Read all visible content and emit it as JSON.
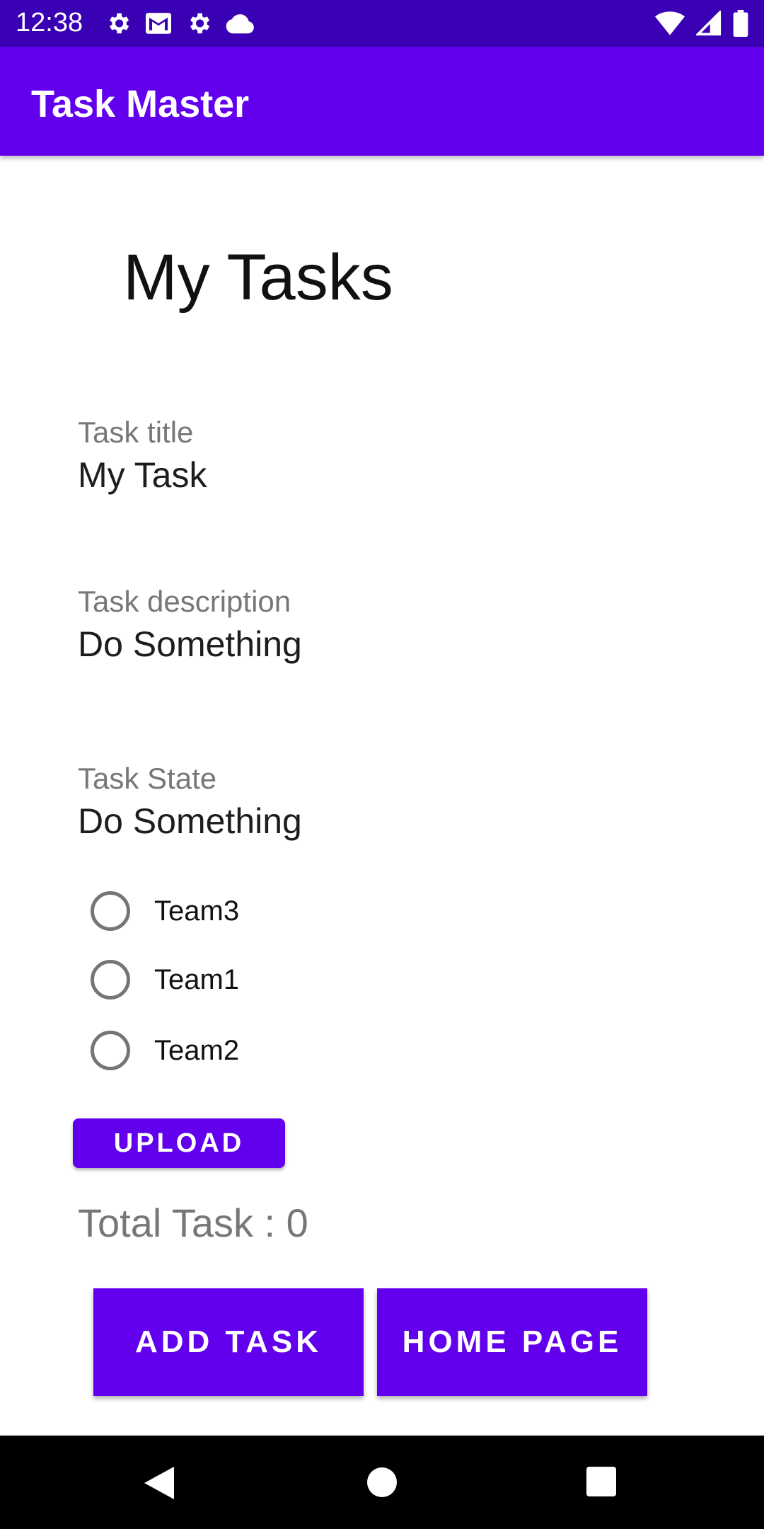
{
  "status_bar": {
    "time": "12:38",
    "left_icons": [
      "gear-icon",
      "gmail-icon",
      "gear-icon",
      "cloud-icon"
    ],
    "right_icons": [
      "wifi-icon",
      "signal-icon",
      "battery-icon"
    ]
  },
  "app_bar": {
    "title": "Task Master",
    "color": "#6200ee"
  },
  "page": {
    "heading": "My Tasks"
  },
  "fields": [
    {
      "label": "Task title",
      "value": "My Task"
    },
    {
      "label": "Task description",
      "value": "Do Something"
    },
    {
      "label": "Task State",
      "value": "Do Something"
    }
  ],
  "teams": [
    {
      "label": "Team3",
      "selected": false
    },
    {
      "label": "Team1",
      "selected": false
    },
    {
      "label": "Team2",
      "selected": false
    }
  ],
  "upload_button": {
    "label": "UPLOAD"
  },
  "total_text": "Total Task : 0",
  "buttons": {
    "add_task": "ADD TASK",
    "home_page": "HOME PAGE"
  },
  "nav_bar": {
    "icons": [
      "back-icon",
      "home-icon",
      "recents-icon"
    ]
  }
}
